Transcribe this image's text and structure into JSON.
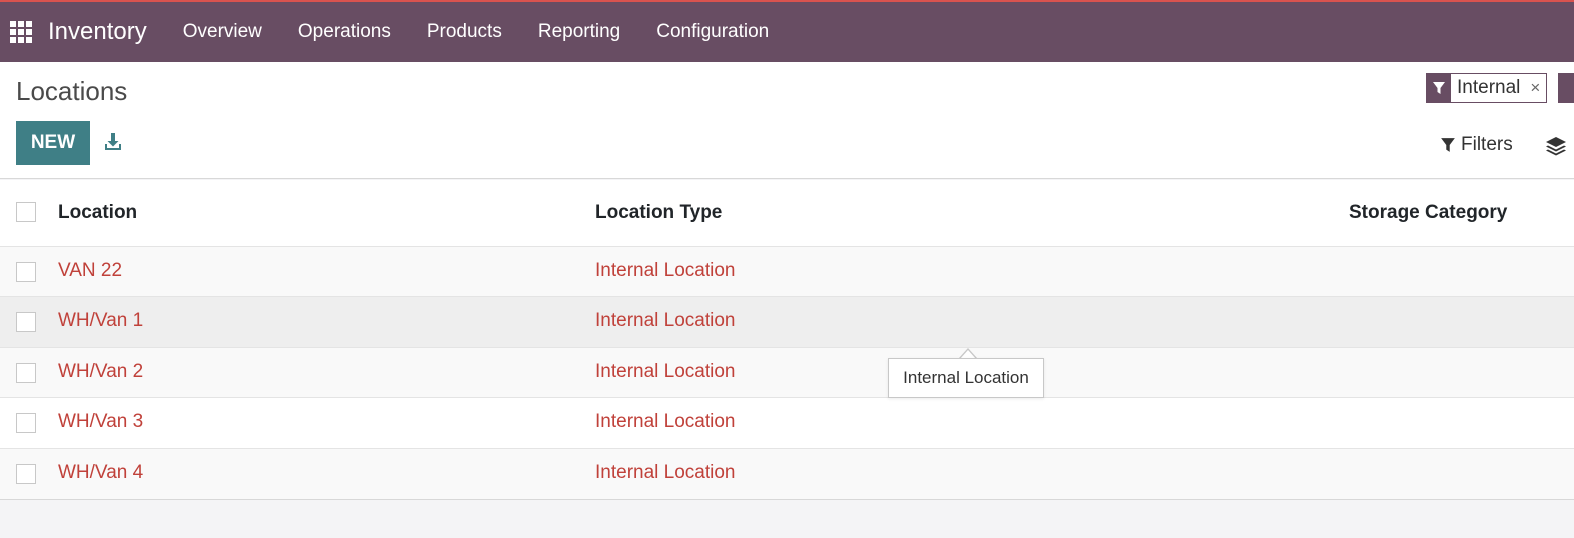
{
  "app": {
    "name": "Inventory",
    "menu": [
      "Overview",
      "Operations",
      "Products",
      "Reporting",
      "Configuration"
    ]
  },
  "page": {
    "title": "Locations",
    "new_label": "NEW"
  },
  "search": {
    "facet_value": "Internal",
    "facet_remove": "×",
    "filters_label": "Filters"
  },
  "table": {
    "columns": [
      "Location",
      "Location Type",
      "Storage Category"
    ],
    "rows": [
      {
        "location": "VAN 22",
        "type": "Internal Location",
        "storage": ""
      },
      {
        "location": "WH/Van 1",
        "type": "Internal Location",
        "storage": ""
      },
      {
        "location": "WH/Van 2",
        "type": "Internal Location",
        "storage": ""
      },
      {
        "location": "WH/Van 3",
        "type": "Internal Location",
        "storage": ""
      },
      {
        "location": "WH/Van 4",
        "type": "Internal Location",
        "storage": ""
      }
    ]
  },
  "tooltip": {
    "text": "Internal Location"
  },
  "colors": {
    "navbar": "#684d63",
    "primary_button": "#3f7f86",
    "link": "#c0413a"
  },
  "icons": {
    "apps": "apps-grid-icon",
    "download": "download-icon",
    "filter": "filter-icon",
    "layers": "layers-icon"
  }
}
